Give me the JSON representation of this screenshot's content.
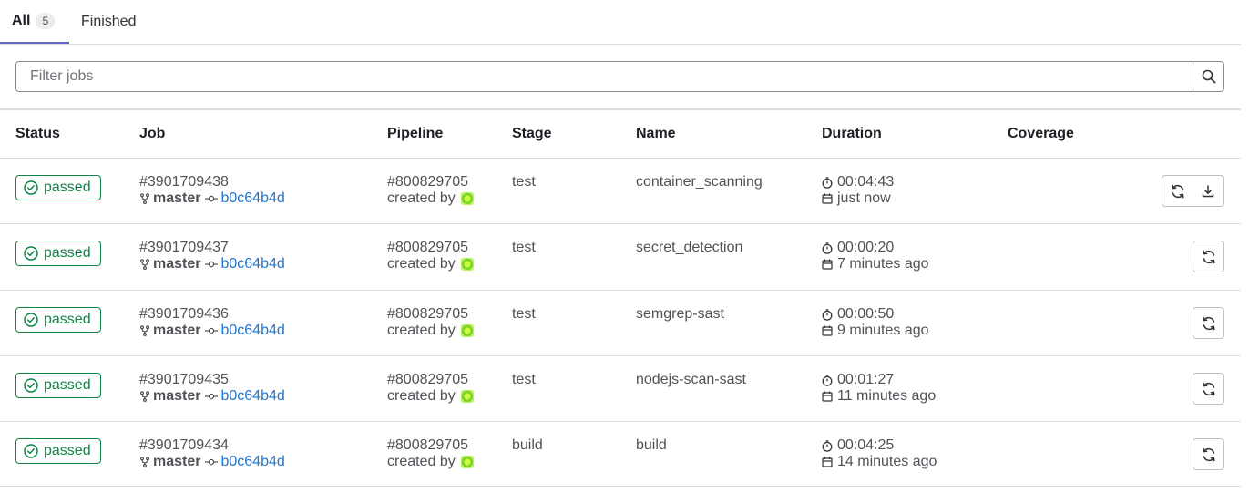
{
  "tabs": {
    "all_label": "All",
    "all_count": "5",
    "finished_label": "Finished"
  },
  "filter": {
    "placeholder": "Filter jobs"
  },
  "table": {
    "headers": {
      "status": "Status",
      "job": "Job",
      "pipeline": "Pipeline",
      "stage": "Stage",
      "name": "Name",
      "duration": "Duration",
      "coverage": "Coverage"
    },
    "rows": [
      {
        "status": "passed",
        "job_id": "#3901709438",
        "ref": "master",
        "sha": "b0c64b4d",
        "pipeline": "#800829705",
        "created_by": "created by",
        "stage": "test",
        "name": "container_scanning",
        "duration": "00:04:43",
        "finished": "just now"
      },
      {
        "status": "passed",
        "job_id": "#3901709437",
        "ref": "master",
        "sha": "b0c64b4d",
        "pipeline": "#800829705",
        "created_by": "created by",
        "stage": "test",
        "name": "secret_detection",
        "duration": "00:00:20",
        "finished": "7 minutes ago"
      },
      {
        "status": "passed",
        "job_id": "#3901709436",
        "ref": "master",
        "sha": "b0c64b4d",
        "pipeline": "#800829705",
        "created_by": "created by",
        "stage": "test",
        "name": "semgrep-sast",
        "duration": "00:00:50",
        "finished": "9 minutes ago"
      },
      {
        "status": "passed",
        "job_id": "#3901709435",
        "ref": "master",
        "sha": "b0c64b4d",
        "pipeline": "#800829705",
        "created_by": "created by",
        "stage": "test",
        "name": "nodejs-scan-sast",
        "duration": "00:01:27",
        "finished": "11 minutes ago"
      },
      {
        "status": "passed",
        "job_id": "#3901709434",
        "ref": "master",
        "sha": "b0c64b4d",
        "pipeline": "#800829705",
        "created_by": "created by",
        "stage": "build",
        "name": "build",
        "duration": "00:04:25",
        "finished": "14 minutes ago"
      }
    ]
  },
  "colors": {
    "success": "#108548",
    "link": "#1f75cb",
    "active_tab": "#6666c4"
  },
  "icons": {
    "search": "search-icon",
    "status": "status-success-icon",
    "branch": "branch-icon",
    "commit": "commit-icon",
    "timer": "timer-icon",
    "calendar": "calendar-icon",
    "retry": "retry-icon",
    "download": "download-icon"
  }
}
